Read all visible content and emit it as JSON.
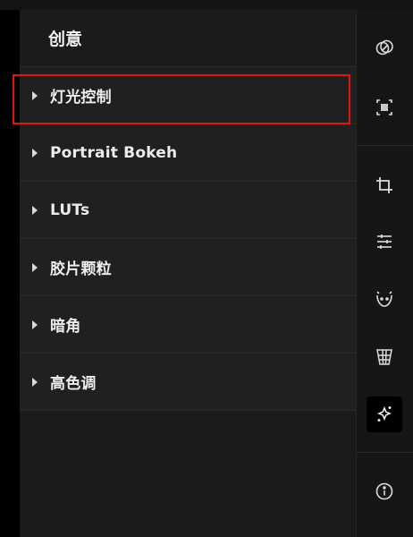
{
  "panel": {
    "title": "创意",
    "sections": [
      {
        "label": "灯光控制",
        "highlighted": true
      },
      {
        "label": "Portrait Bokeh",
        "highlighted": false
      },
      {
        "label": "LUTs",
        "highlighted": false
      },
      {
        "label": "胶片颗粒",
        "highlighted": false
      },
      {
        "label": "暗角",
        "highlighted": false
      },
      {
        "label": "高色调",
        "highlighted": false
      }
    ]
  },
  "toolbar": {
    "tools": [
      {
        "icon": "overlap-circles-icon",
        "active": false
      },
      {
        "icon": "select-frame-icon",
        "active": false
      },
      {
        "icon": "crop-icon",
        "active": false
      },
      {
        "icon": "adjust-sliders-icon",
        "active": false
      },
      {
        "icon": "face-retouch-icon",
        "active": false
      },
      {
        "icon": "perspective-grid-icon",
        "active": false
      },
      {
        "icon": "sparkle-icon",
        "active": true
      },
      {
        "icon": "info-icon",
        "active": false
      }
    ]
  },
  "colors": {
    "highlight_border": "#e01515",
    "panel_bg": "#1a1a1a",
    "section_bg": "#202020",
    "toolbar_bg": "#161616"
  }
}
